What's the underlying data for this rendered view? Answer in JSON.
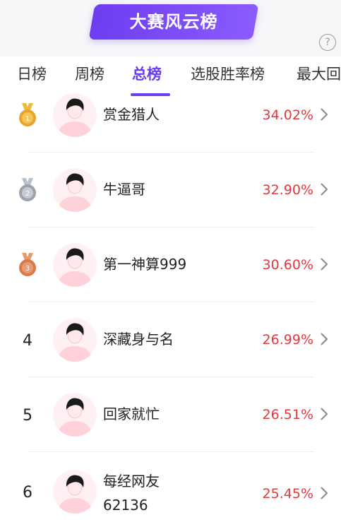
{
  "header": {
    "title": "大赛风云榜",
    "help": "?"
  },
  "tabs": [
    {
      "label": "日榜",
      "active": false
    },
    {
      "label": "周榜",
      "active": false
    },
    {
      "label": "总榜",
      "active": true
    },
    {
      "label": "选股胜率榜",
      "active": false
    },
    {
      "label": "最大回",
      "active": false
    }
  ],
  "rows": [
    {
      "rank": "1",
      "medal": "gold",
      "name": "赏金猎人",
      "name2": "",
      "rate": "34.02%"
    },
    {
      "rank": "2",
      "medal": "silver",
      "name": "牛逼哥",
      "name2": "",
      "rate": "32.90%"
    },
    {
      "rank": "3",
      "medal": "bronze",
      "name": "第一神算999",
      "name2": "",
      "rate": "30.60%"
    },
    {
      "rank": "4",
      "medal": "",
      "name": "深藏身与名",
      "name2": "",
      "rate": "26.99%"
    },
    {
      "rank": "5",
      "medal": "",
      "name": "回家就忙",
      "name2": "",
      "rate": "26.51%"
    },
    {
      "rank": "6",
      "medal": "",
      "name": "每经网友",
      "name2": "62136",
      "rate": "25.45%"
    }
  ],
  "colors": {
    "accent": "#6a3ef0",
    "rate": "#e0393e",
    "gold": "#e8a42c",
    "silver": "#9aa3ad",
    "bronze": "#d97a4a"
  }
}
